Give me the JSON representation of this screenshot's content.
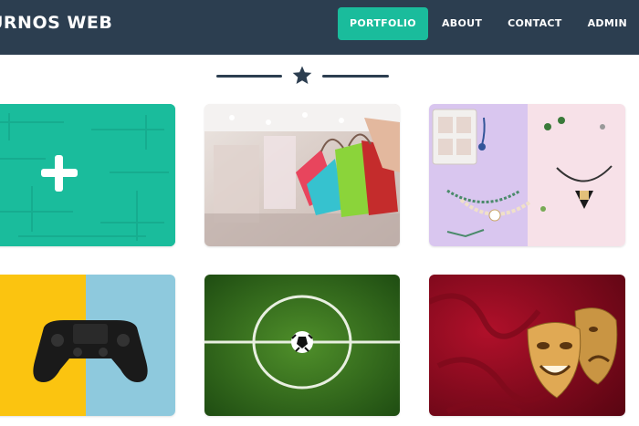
{
  "navbar": {
    "brand": "URNOS WEB",
    "items": [
      {
        "label": "PORTFOLIO",
        "active": true
      },
      {
        "label": "ABOUT",
        "active": false
      },
      {
        "label": "CONTACT",
        "active": false
      },
      {
        "label": "ADMIN",
        "active": false
      }
    ]
  },
  "divider": {
    "icon": "star-icon"
  },
  "portfolio": {
    "tiles": [
      {
        "name": "add-item",
        "icon": "plus-icon"
      },
      {
        "name": "shopping"
      },
      {
        "name": "jewelry"
      },
      {
        "name": "video-games"
      },
      {
        "name": "soccer"
      },
      {
        "name": "theater"
      }
    ]
  },
  "colors": {
    "navbar": "#2c3e50",
    "accent": "#1abc9c",
    "nav_text": "#ffffff",
    "divider": "#2c3e50"
  }
}
